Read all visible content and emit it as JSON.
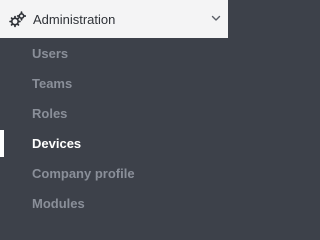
{
  "section": {
    "title": "Administration",
    "icon": "gears-icon",
    "expanded": true,
    "toggle_icon": "chevron-down-icon"
  },
  "items": [
    {
      "label": "Users",
      "active": false
    },
    {
      "label": "Teams",
      "active": false
    },
    {
      "label": "Roles",
      "active": false
    },
    {
      "label": "Devices",
      "active": true
    },
    {
      "label": "Company profile",
      "active": false
    },
    {
      "label": "Modules",
      "active": false
    }
  ],
  "colors": {
    "header_background": "#f4f4f5",
    "menu_background": "#3d414a",
    "item_text": "#8a8f99",
    "active_text": "#ffffff",
    "active_indicator": "#ffffff"
  }
}
